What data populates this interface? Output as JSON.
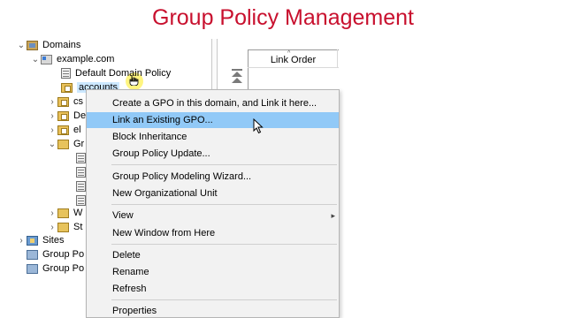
{
  "heading": "Group Policy Management",
  "tree": {
    "domains": {
      "label": "Domains",
      "chevron": "⌄"
    },
    "domain": {
      "label": "example.com",
      "chevron": "⌄"
    },
    "default_gpo": {
      "label": "Default Domain Policy"
    },
    "selected_ou": {
      "label": "accounts"
    },
    "child1": {
      "label": "cs",
      "chevron": "›"
    },
    "child2": {
      "label": "De",
      "chevron": "›"
    },
    "child3": {
      "label": "el",
      "chevron": "›"
    },
    "child4": {
      "label": "Gr",
      "chevron": "⌄"
    },
    "child5": {
      "label": "W",
      "chevron": "›"
    },
    "child6": {
      "label": "St",
      "chevron": "›"
    },
    "sites": {
      "label": "Sites",
      "chevron": "›"
    },
    "gp_modeling": {
      "label": "Group Po"
    },
    "gp_results": {
      "label": "Group Po"
    }
  },
  "link_table": {
    "column_header": "Link Order",
    "sort_glyph": "^"
  },
  "context_menu": {
    "create_gpo": "Create a GPO in this domain, and Link it here...",
    "link_existing": "Link an Existing GPO...",
    "block_inheritance": "Block Inheritance",
    "gp_update": "Group Policy Update...",
    "modeling_wizard": "Group Policy Modeling Wizard...",
    "new_ou": "New Organizational Unit",
    "view": "View",
    "new_window": "New Window from Here",
    "delete": "Delete",
    "rename": "Rename",
    "refresh": "Refresh",
    "properties": "Properties"
  },
  "colors": {
    "heading": "#c8102e",
    "menu_highlight": "#91c9f7",
    "tree_selection": "#cce8ff"
  },
  "icons": {
    "hand": "hand-cursor-icon",
    "arrow": "arrow-pointer-icon",
    "submenu": "chevron-right-icon"
  }
}
